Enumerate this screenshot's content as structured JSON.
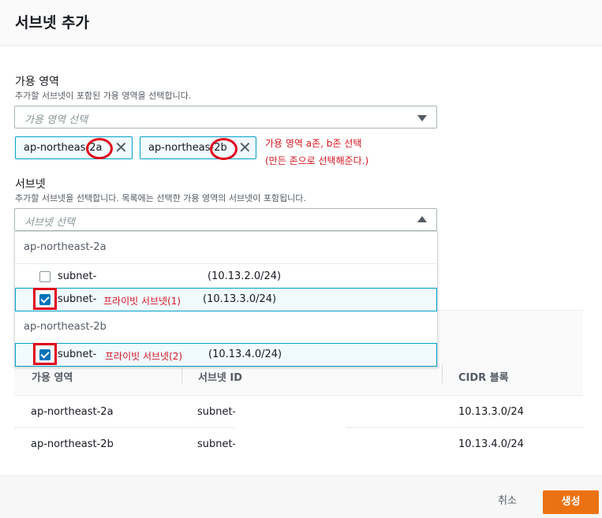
{
  "modal": {
    "title": "서브넷 추가"
  },
  "az_section": {
    "label": "가용 영역",
    "description": "추가할 서브넷이 포함된 가용 영역을 선택합니다.",
    "placeholder": "가용 영역 선택",
    "tokens": [
      {
        "prefix": "ap-northeas",
        "suffix": "-2a"
      },
      {
        "prefix": "ap-northeas",
        "suffix": "-2b"
      }
    ],
    "annotation_line1": "가용 영역 a존, b존 선택",
    "annotation_line2": "(만든 존으로 선택해준다.)"
  },
  "subnet_section": {
    "label": "서브넷",
    "description": "추가할 서브넷을 선택합니다. 목록에는 선택한 가용 영역의 서브넷이 포함됩니다.",
    "placeholder": "서브넷 선택",
    "groups": [
      {
        "name": "ap-northeast-2a",
        "options": [
          {
            "id": "subnet-",
            "annotation": "",
            "cidr": "(10.13.2.0/24)",
            "checked": false
          },
          {
            "id": "subnet-",
            "annotation": "프라이빗 서브넷(1)",
            "cidr": "(10.13.3.0/24)",
            "checked": true
          }
        ]
      },
      {
        "name": "ap-northeast-2b",
        "options": [
          {
            "id": "subnet-",
            "annotation": "프라이빗 서브넷(2)",
            "cidr": "(10.13.4.0/24)",
            "checked": true
          }
        ]
      }
    ]
  },
  "table": {
    "headers": [
      "가용 영역",
      "서브넷 ID",
      "CIDR 블록"
    ],
    "rows": [
      [
        "ap-northeast-2a",
        "subnet-",
        "10.13.3.0/24"
      ],
      [
        "ap-northeast-2b",
        "subnet-",
        "10.13.4.0/24"
      ]
    ]
  },
  "footer": {
    "cancel_label": "취소",
    "create_label": "생성"
  },
  "colors": {
    "accent": "#0073bb",
    "primary_button": "#ec7211",
    "annotation": "#d5141f"
  }
}
